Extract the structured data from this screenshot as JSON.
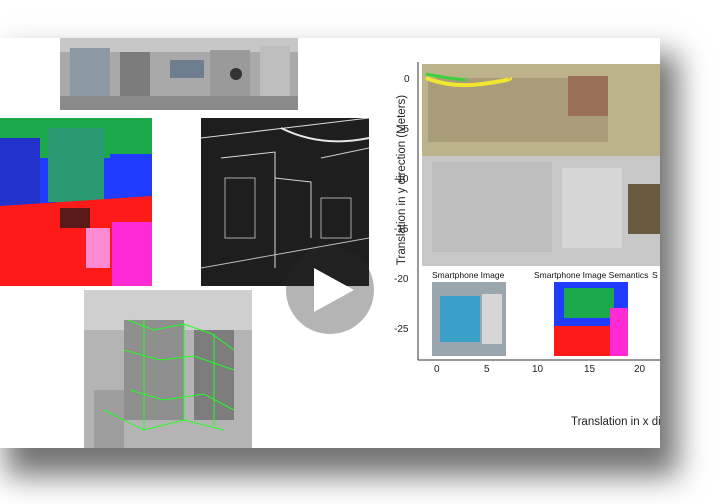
{
  "video": {
    "play_icon": "play-icon"
  },
  "plot": {
    "ylabel": "Translation in y direction (Meters)",
    "xlabel": "Translation in x di",
    "yticks": [
      "0",
      "-5",
      "-10",
      "-15",
      "-20",
      "-25"
    ],
    "xticks": [
      "0",
      "5",
      "10",
      "15",
      "20"
    ],
    "insets": {
      "smartphone_image": "Smartphone Image",
      "smartphone_semantics": "Smartphone Image Semantics",
      "cut_label": "S"
    }
  },
  "colors": {
    "trajectory_green": "#3cd23c",
    "trajectory_yellow": "#f0e630",
    "semantic_red": "#ff1a1a",
    "semantic_blue": "#1f3cff",
    "semantic_green": "#1aa84a",
    "semantic_magenta": "#ff2ad4",
    "feature_green": "#22ff22"
  }
}
